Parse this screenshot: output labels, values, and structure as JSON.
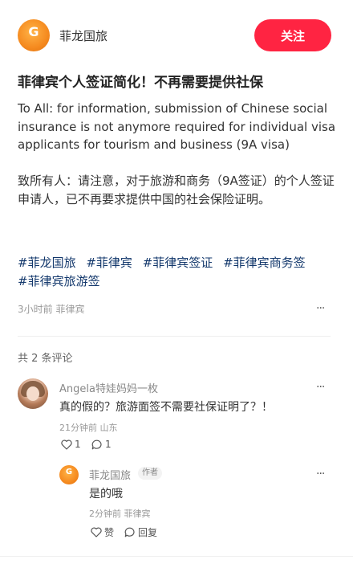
{
  "header": {
    "author_name": "菲龙国旅",
    "follow_label": "关注"
  },
  "post": {
    "title": "菲律宾个人签证简化！不再需要提供社保",
    "body": "To All: for information, submission of Chinese social insurance is not anymore required for individual visa applicants for tourism and business (9A visa)\n\n致所有人：请注意，对于旅游和商务（9A签证）的个人签证申请人，已不再要求提供中国的社会保险证明。",
    "tags": [
      "#菲龙国旅",
      "#菲律宾",
      "#菲律宾签证",
      "#菲律宾商务签",
      "#菲律宾旅游签"
    ],
    "time_location": "3小时前 菲律宾",
    "more_icon": "more-dots-icon"
  },
  "comments": {
    "count_label": "共 2 条评论",
    "items": [
      {
        "name": "Angela特娃妈妈一枚",
        "text": "真的假的？旅游面签不需要社保证明了？！",
        "meta": "21分钟前 山东",
        "likes": "1",
        "replies": "1",
        "reply": {
          "name": "菲龙国旅",
          "badge": "作者",
          "text": "是的哦",
          "meta": "2分钟前 菲律宾",
          "like_label": "赞",
          "reply_label": "回复"
        }
      }
    ]
  },
  "colors": {
    "accent": "#ff2442",
    "tag": "#13386c",
    "logo": "#f58a1f"
  }
}
